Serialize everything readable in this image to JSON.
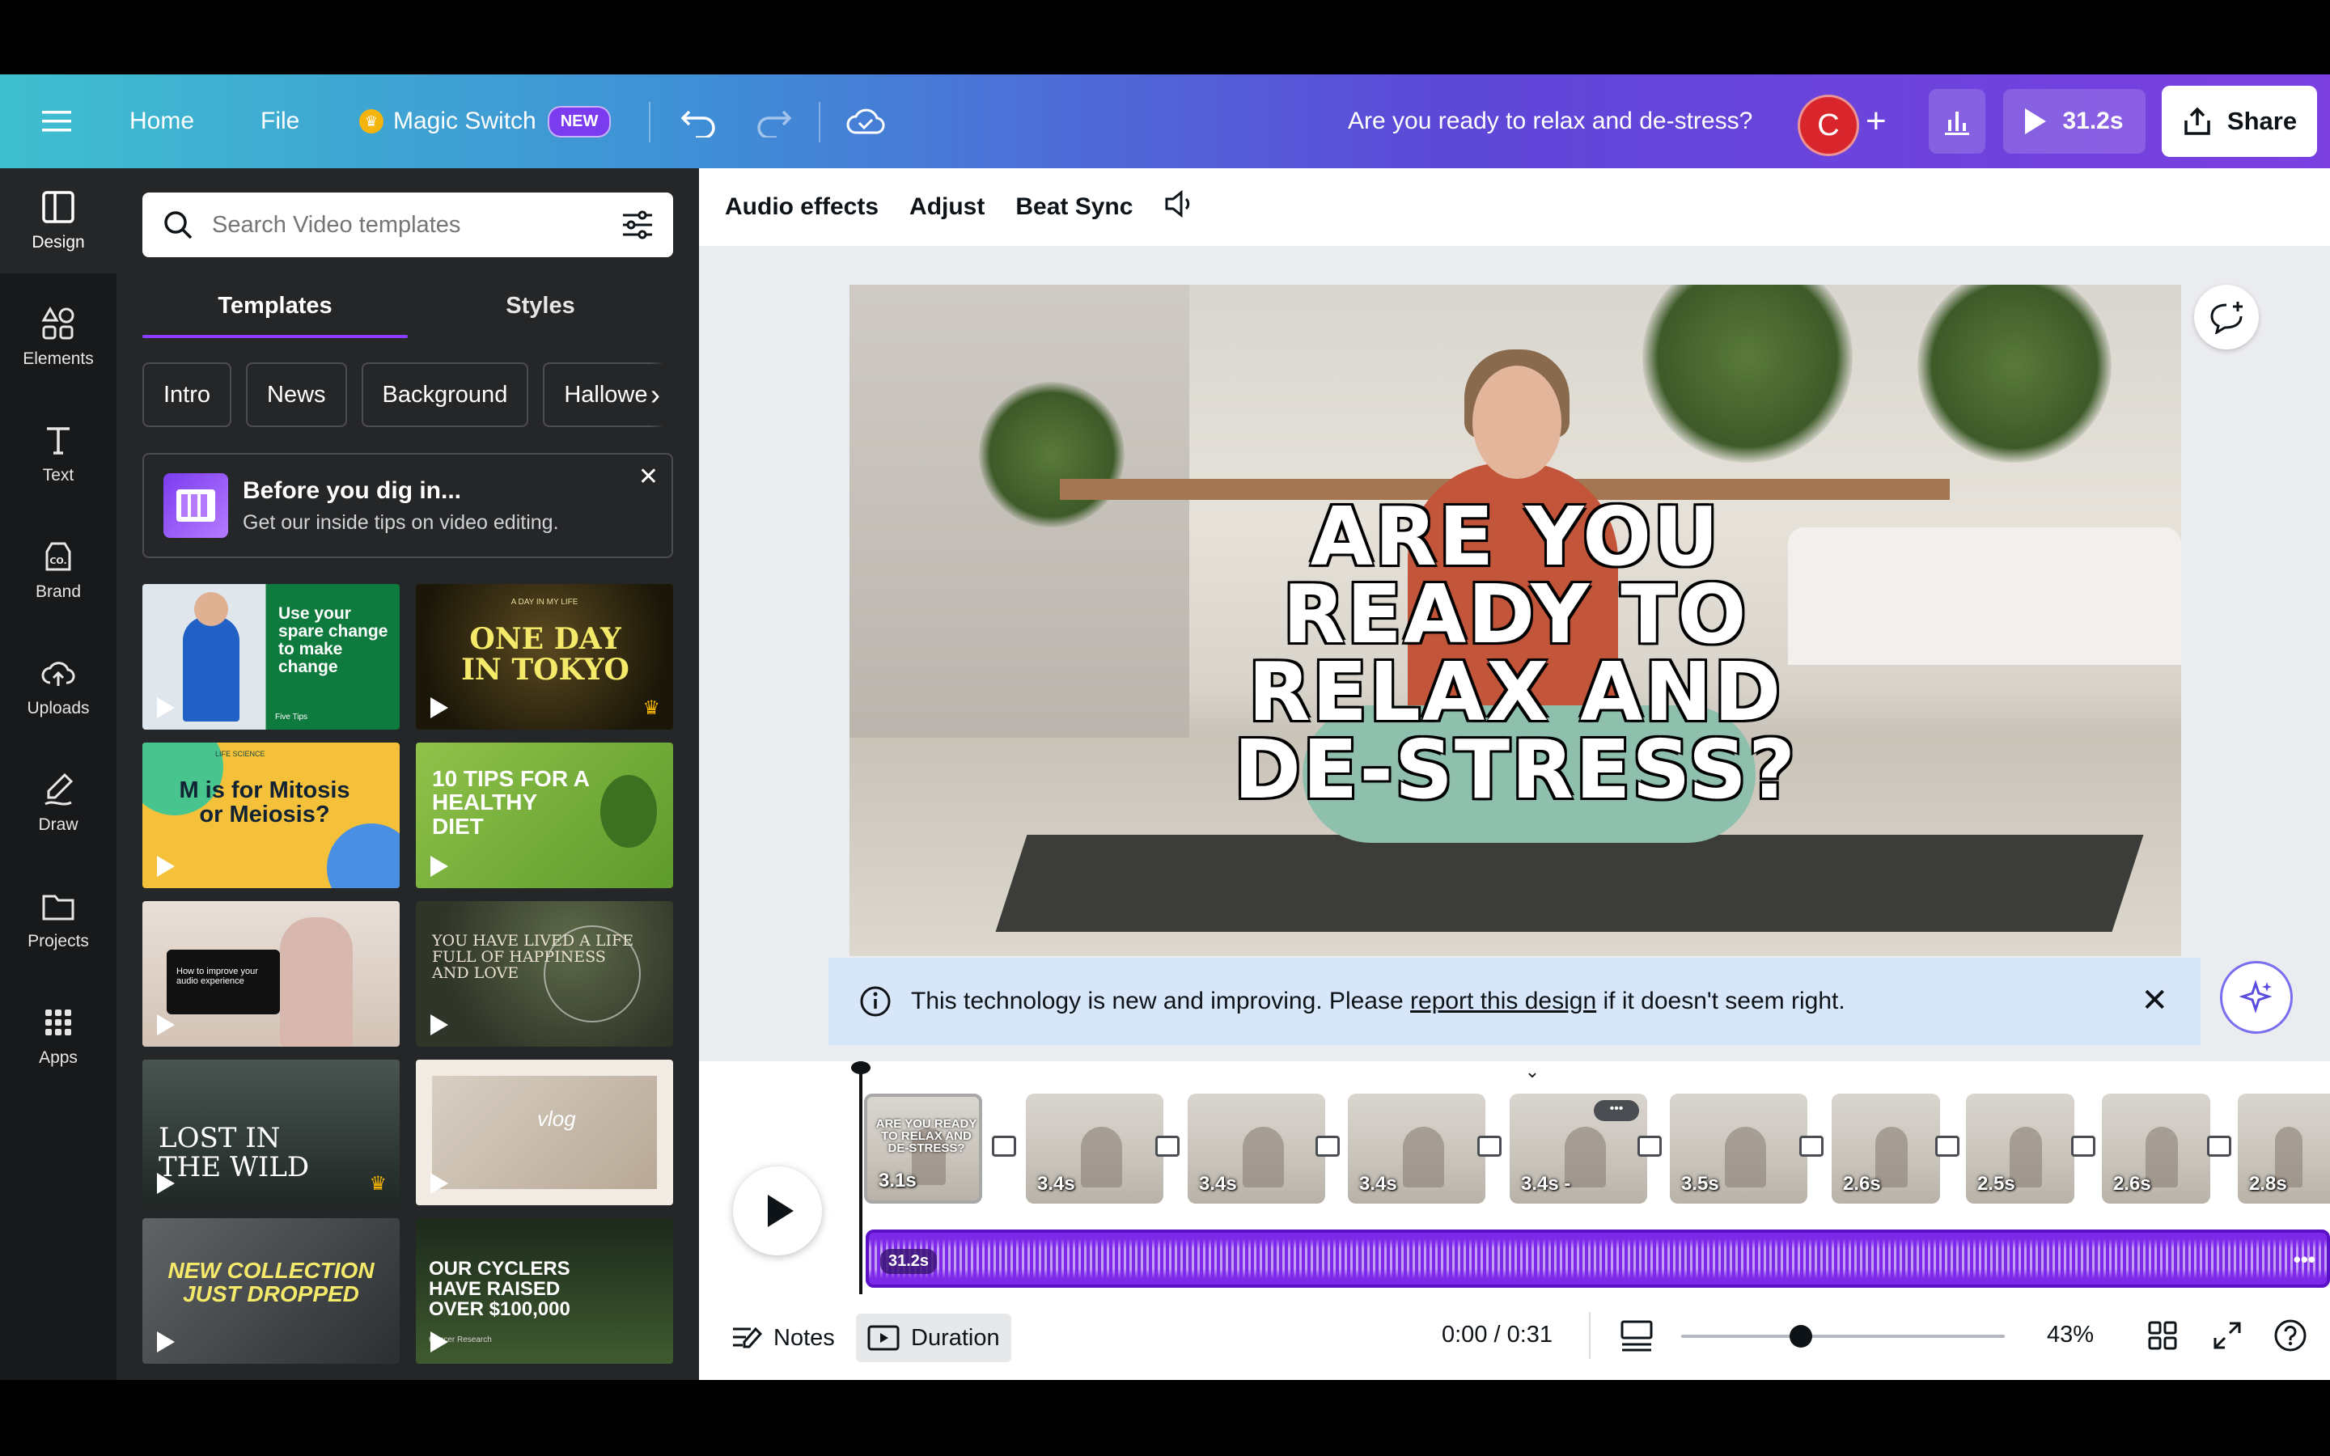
{
  "topbar": {
    "home": "Home",
    "file": "File",
    "magic_switch": "Magic Switch",
    "new_badge": "NEW",
    "design_title": "Are you ready to relax and de-stress?",
    "avatar_letter": "C",
    "play_duration": "31.2s",
    "share": "Share"
  },
  "rail": {
    "items": [
      {
        "label": "Design",
        "icon": "design-icon"
      },
      {
        "label": "Elements",
        "icon": "elements-icon"
      },
      {
        "label": "Text",
        "icon": "text-icon"
      },
      {
        "label": "Brand",
        "icon": "brand-icon"
      },
      {
        "label": "Uploads",
        "icon": "uploads-icon"
      },
      {
        "label": "Draw",
        "icon": "draw-icon"
      },
      {
        "label": "Projects",
        "icon": "projects-icon"
      },
      {
        "label": "Apps",
        "icon": "apps-icon"
      }
    ]
  },
  "panel": {
    "search_placeholder": "Search Video templates",
    "tabs": [
      "Templates",
      "Styles"
    ],
    "chips": [
      "Intro",
      "News",
      "Background",
      "Hallowe"
    ],
    "tip": {
      "title": "Before you dig in...",
      "subtitle": "Get our inside tips on video editing."
    },
    "thumbnails": [
      {
        "text": "Use your spare change to make change",
        "small": "Five Tips"
      },
      {
        "text": "ONE DAY IN TOKYO",
        "small": "A DAY IN MY LIFE"
      },
      {
        "text": "M is for Mitosis or Meiosis?",
        "small": "LIFE SCIENCE"
      },
      {
        "text": "10 TIPS FOR A HEALTHY DIET",
        "small": ""
      },
      {
        "text": "How to improve your audio experience",
        "small": ""
      },
      {
        "text": "YOU HAVE LIVED A LIFE FULL OF HAPPINESS AND LOVE",
        "small": ""
      },
      {
        "text": "LOST IN THE WILD",
        "small": ""
      },
      {
        "text": "vlog",
        "small": ""
      },
      {
        "text": "NEW COLLECTION JUST DROPPED",
        "small": ""
      },
      {
        "text": "OUR CYCLERS HAVE RAISED OVER $100,000",
        "small": "Cancer Research"
      }
    ]
  },
  "editor": {
    "context_bar": [
      "Audio effects",
      "Adjust",
      "Beat Sync"
    ],
    "headline": "ARE YOU READY TO RELAX AND DE-STRESS?",
    "notice": {
      "before": "This technology is new and improving. Please",
      "link": "report this design",
      "after": "if it doesn't seem right."
    }
  },
  "timeline": {
    "clips": [
      "3.1s",
      "3.4s",
      "3.4s",
      "3.4s",
      "3.4s -",
      "3.5s",
      "2.6s",
      "2.5s",
      "2.6s",
      "2.8s"
    ],
    "audio_duration": "31.2s",
    "audio_more": "•••"
  },
  "footer": {
    "notes": "Notes",
    "duration": "Duration",
    "time": "0:00 / 0:31",
    "zoom": "43%",
    "zoom_level": 0.37
  },
  "colors": {
    "accent": "#8b3dff",
    "audio_track": "#7d2ae8",
    "avatar": "#d9262c"
  }
}
